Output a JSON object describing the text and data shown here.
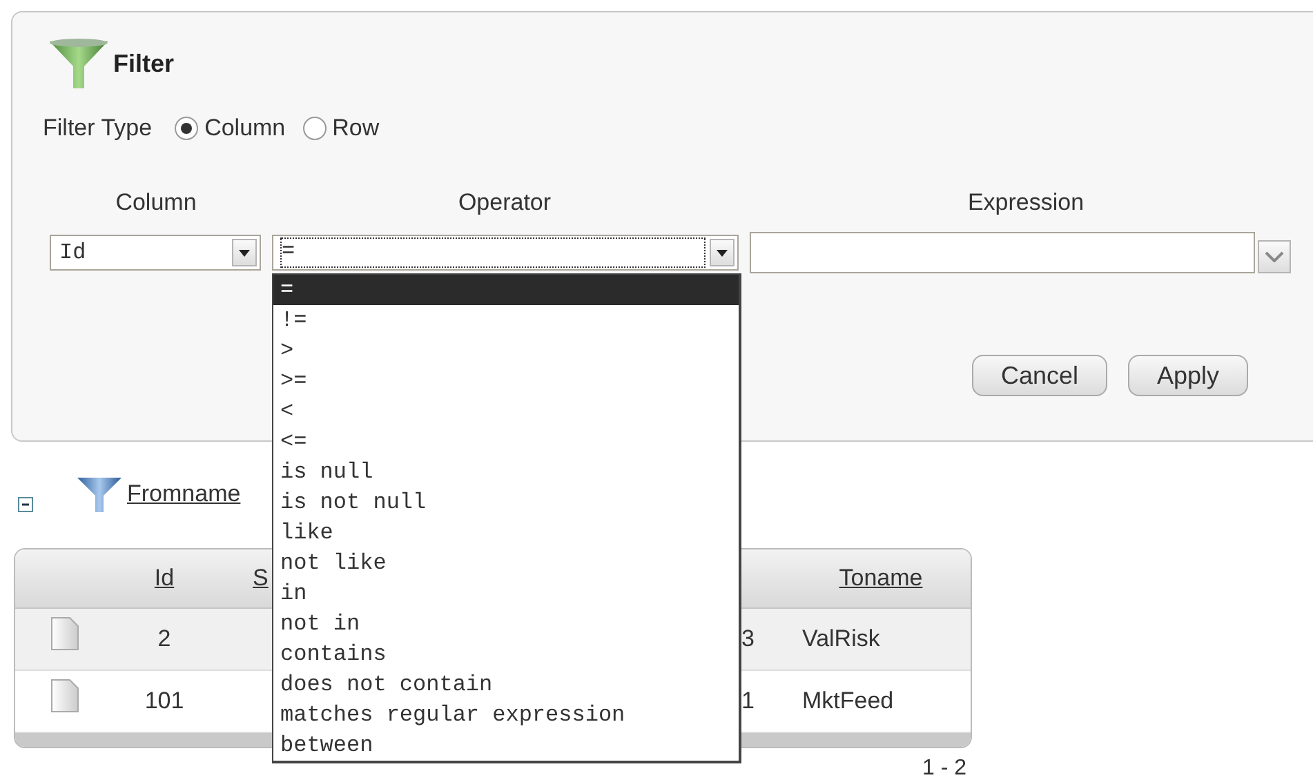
{
  "filter_panel": {
    "title": "Filter",
    "filter_type": {
      "label": "Filter Type",
      "options": [
        {
          "label": "Column",
          "selected": true
        },
        {
          "label": "Row",
          "selected": false
        }
      ]
    },
    "headers": [
      "Column",
      "Operator",
      "Expression"
    ],
    "column_select": {
      "value": "Id"
    },
    "operator_select": {
      "value": "=",
      "expanded": true
    },
    "buttons": [
      "Cancel",
      "Apply"
    ]
  },
  "operator_options": [
    {
      "label": "=",
      "selected": true
    },
    {
      "label": "!=",
      "selected": false
    },
    {
      "label": ">",
      "selected": false
    },
    {
      "label": ">=",
      "selected": false
    },
    {
      "label": "<",
      "selected": false
    },
    {
      "label": "<=",
      "selected": false
    },
    {
      "label": "is null",
      "selected": false
    },
    {
      "label": "is not null",
      "selected": false
    },
    {
      "label": "like",
      "selected": false
    },
    {
      "label": "not like",
      "selected": false
    },
    {
      "label": "in",
      "selected": false
    },
    {
      "label": "not in",
      "selected": false
    },
    {
      "label": "contains",
      "selected": false
    },
    {
      "label": "does not contain",
      "selected": false
    },
    {
      "label": "matches regular expression",
      "selected": false
    },
    {
      "label": "between",
      "selected": false
    }
  ],
  "active_filter": {
    "expanded": true,
    "link": "Fromname"
  },
  "table": {
    "columns": [
      "Id",
      "S",
      "",
      "Toname"
    ],
    "rows": [
      [
        "2",
        "",
        "3",
        "ValRisk"
      ],
      [
        "101",
        "",
        "1",
        "MktFeed"
      ]
    ]
  },
  "pagination": "1 - 2"
}
